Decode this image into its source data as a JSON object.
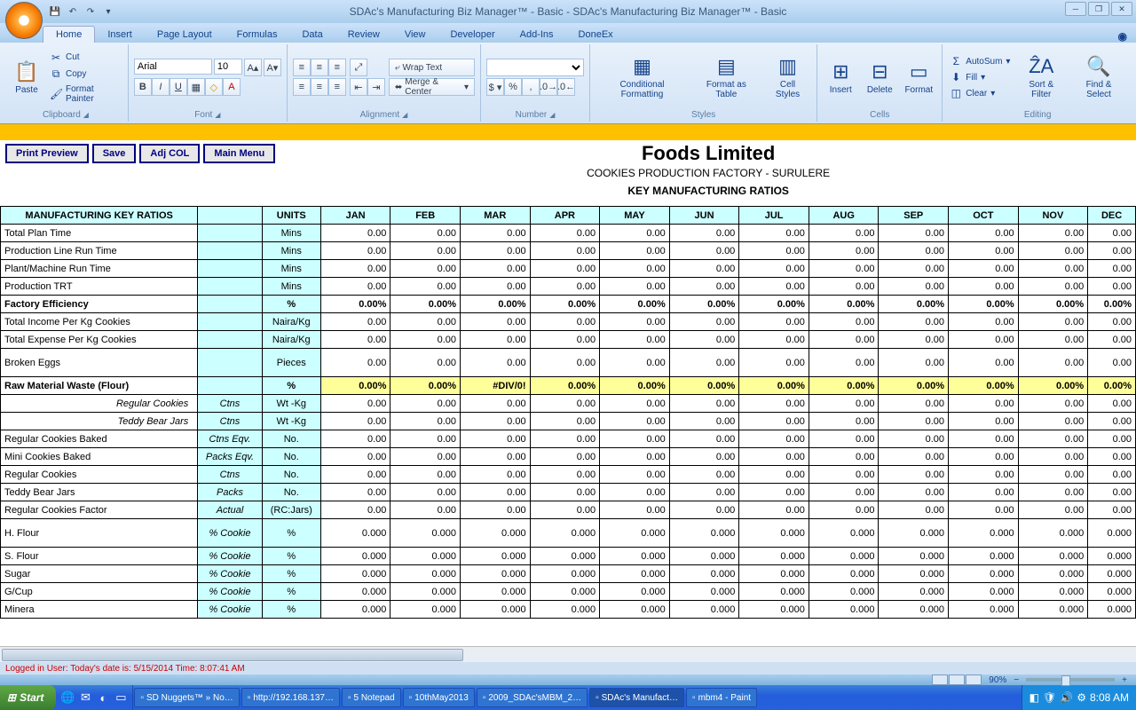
{
  "app": {
    "title": "SDAc's Manufacturing Biz Manager™ - Basic - SDAc's Manufacturing Biz Manager™ - Basic",
    "tabs": [
      "Home",
      "Insert",
      "Page Layout",
      "Formulas",
      "Data",
      "Review",
      "View",
      "Developer",
      "Add-Ins",
      "DoneEx"
    ]
  },
  "clipboard": {
    "paste": "Paste",
    "cut": "Cut",
    "copy": "Copy",
    "fp": "Format Painter",
    "label": "Clipboard"
  },
  "font": {
    "name": "Arial",
    "size": "10",
    "label": "Font"
  },
  "alignment": {
    "wrap": "Wrap Text",
    "merge": "Merge & Center",
    "label": "Alignment"
  },
  "number": {
    "label": "Number"
  },
  "styles": {
    "cond": "Conditional Formatting",
    "fas": "Format as Table",
    "cell": "Cell Styles",
    "label": "Styles"
  },
  "cells": {
    "insert": "Insert",
    "delete": "Delete",
    "format": "Format",
    "label": "Cells"
  },
  "editing": {
    "autosum": "AutoSum",
    "fill": "Fill",
    "clear": "Clear",
    "sort": "Sort & Filter",
    "find": "Find & Select",
    "label": "Editing"
  },
  "sheet": {
    "actions": {
      "preview": "Print Preview",
      "save": "Save",
      "adj": "Adj COL",
      "menu": "Main Menu"
    },
    "company": "Foods Limited",
    "subtitle": "COOKIES PRODUCTION FACTORY - SURULERE",
    "keytitle": "KEY MANUFACTURING RATIOS",
    "th_label": "MANUFACTURING KEY RATIOS",
    "th_units": "UNITS",
    "months": [
      "JAN",
      "FEB",
      "MAR",
      "APR",
      "MAY",
      "JUN",
      "JUL",
      "AUG",
      "SEP",
      "OCT",
      "NOV",
      "DEC"
    ],
    "rows": [
      {
        "label": "Total Plan Time",
        "sub": "",
        "units": "Mins",
        "vals": [
          "0.00",
          "0.00",
          "0.00",
          "0.00",
          "0.00",
          "0.00",
          "0.00",
          "0.00",
          "0.00",
          "0.00",
          "0.00",
          "0.00"
        ]
      },
      {
        "label": "Production Line Run Time",
        "sub": "",
        "units": "Mins",
        "vals": [
          "0.00",
          "0.00",
          "0.00",
          "0.00",
          "0.00",
          "0.00",
          "0.00",
          "0.00",
          "0.00",
          "0.00",
          "0.00",
          "0.00"
        ]
      },
      {
        "label": "Plant/Machine Run Time",
        "sub": "",
        "units": "Mins",
        "vals": [
          "0.00",
          "0.00",
          "0.00",
          "0.00",
          "0.00",
          "0.00",
          "0.00",
          "0.00",
          "0.00",
          "0.00",
          "0.00",
          "0.00"
        ]
      },
      {
        "label": "Production TRT",
        "sub": "",
        "units": "Mins",
        "vals": [
          "0.00",
          "0.00",
          "0.00",
          "0.00",
          "0.00",
          "0.00",
          "0.00",
          "0.00",
          "0.00",
          "0.00",
          "0.00",
          "0.00"
        ]
      },
      {
        "label": "Factory Efficiency",
        "sub": "",
        "units": "%",
        "vals": [
          "0.00%",
          "0.00%",
          "0.00%",
          "0.00%",
          "0.00%",
          "0.00%",
          "0.00%",
          "0.00%",
          "0.00%",
          "0.00%",
          "0.00%",
          "0.00%"
        ],
        "bold": true
      },
      {
        "label": "Total Income Per Kg Cookies",
        "sub": "",
        "units": "Naira/Kg",
        "vals": [
          "0.00",
          "0.00",
          "0.00",
          "0.00",
          "0.00",
          "0.00",
          "0.00",
          "0.00",
          "0.00",
          "0.00",
          "0.00",
          "0.00"
        ]
      },
      {
        "label": "Total Expense Per Kg Cookies",
        "sub": "",
        "units": "Naira/Kg",
        "vals": [
          "0.00",
          "0.00",
          "0.00",
          "0.00",
          "0.00",
          "0.00",
          "0.00",
          "0.00",
          "0.00",
          "0.00",
          "0.00",
          "0.00"
        ]
      },
      {
        "label": "Broken Eggs",
        "sub": "",
        "units": "Pieces",
        "vals": [
          "0.00",
          "0.00",
          "0.00",
          "0.00",
          "0.00",
          "0.00",
          "0.00",
          "0.00",
          "0.00",
          "0.00",
          "0.00",
          "0.00"
        ],
        "big": true
      },
      {
        "label": "Raw Material Waste (Flour)",
        "sub": "",
        "units": "%",
        "vals": [
          "0.00%",
          "0.00%",
          "#DIV/0!",
          "0.00%",
          "0.00%",
          "0.00%",
          "0.00%",
          "0.00%",
          "0.00%",
          "0.00%",
          "0.00%",
          "0.00%"
        ],
        "yellow": true,
        "bold": true
      },
      {
        "label": "Regular Cookies",
        "sub": "Ctns",
        "units": "Wt -Kg",
        "vals": [
          "0.00",
          "0.00",
          "0.00",
          "0.00",
          "0.00",
          "0.00",
          "0.00",
          "0.00",
          "0.00",
          "0.00",
          "0.00",
          "0.00"
        ],
        "indent": true
      },
      {
        "label": "Teddy Bear Jars",
        "sub": "Ctns",
        "units": "Wt -Kg",
        "vals": [
          "0.00",
          "0.00",
          "0.00",
          "0.00",
          "0.00",
          "0.00",
          "0.00",
          "0.00",
          "0.00",
          "0.00",
          "0.00",
          "0.00"
        ],
        "indent": true
      },
      {
        "label": "Regular Cookies Baked",
        "sub": "Ctns Eqv.",
        "units": "No.",
        "vals": [
          "0.00",
          "0.00",
          "0.00",
          "0.00",
          "0.00",
          "0.00",
          "0.00",
          "0.00",
          "0.00",
          "0.00",
          "0.00",
          "0.00"
        ]
      },
      {
        "label": "Mini Cookies Baked",
        "sub": "Packs Eqv.",
        "units": "No.",
        "vals": [
          "0.00",
          "0.00",
          "0.00",
          "0.00",
          "0.00",
          "0.00",
          "0.00",
          "0.00",
          "0.00",
          "0.00",
          "0.00",
          "0.00"
        ]
      },
      {
        "label": "Regular Cookies",
        "sub": "Ctns",
        "units": "No.",
        "vals": [
          "0.00",
          "0.00",
          "0.00",
          "0.00",
          "0.00",
          "0.00",
          "0.00",
          "0.00",
          "0.00",
          "0.00",
          "0.00",
          "0.00"
        ]
      },
      {
        "label": "Teddy Bear Jars",
        "sub": "Packs",
        "units": "No.",
        "vals": [
          "0.00",
          "0.00",
          "0.00",
          "0.00",
          "0.00",
          "0.00",
          "0.00",
          "0.00",
          "0.00",
          "0.00",
          "0.00",
          "0.00"
        ]
      },
      {
        "label": "Regular Cookies Factor",
        "sub": "Actual",
        "units": "(RC:Jars)",
        "vals": [
          "0.00",
          "0.00",
          "0.00",
          "0.00",
          "0.00",
          "0.00",
          "0.00",
          "0.00",
          "0.00",
          "0.00",
          "0.00",
          "0.00"
        ]
      },
      {
        "label": "H. Flour",
        "sub": "% Cookie",
        "units": "%",
        "vals": [
          "0.000",
          "0.000",
          "0.000",
          "0.000",
          "0.000",
          "0.000",
          "0.000",
          "0.000",
          "0.000",
          "0.000",
          "0.000",
          "0.000"
        ],
        "big": true
      },
      {
        "label": "S. Flour",
        "sub": "% Cookie",
        "units": "%",
        "vals": [
          "0.000",
          "0.000",
          "0.000",
          "0.000",
          "0.000",
          "0.000",
          "0.000",
          "0.000",
          "0.000",
          "0.000",
          "0.000",
          "0.000"
        ]
      },
      {
        "label": "Sugar",
        "sub": "% Cookie",
        "units": "%",
        "vals": [
          "0.000",
          "0.000",
          "0.000",
          "0.000",
          "0.000",
          "0.000",
          "0.000",
          "0.000",
          "0.000",
          "0.000",
          "0.000",
          "0.000"
        ]
      },
      {
        "label": "G/Cup",
        "sub": "% Cookie",
        "units": "%",
        "vals": [
          "0.000",
          "0.000",
          "0.000",
          "0.000",
          "0.000",
          "0.000",
          "0.000",
          "0.000",
          "0.000",
          "0.000",
          "0.000",
          "0.000"
        ]
      },
      {
        "label": "Minera",
        "sub": "% Cookie",
        "units": "%",
        "vals": [
          "0.000",
          "0.000",
          "0.000",
          "0.000",
          "0.000",
          "0.000",
          "0.000",
          "0.000",
          "0.000",
          "0.000",
          "0.000",
          "0.000"
        ]
      }
    ]
  },
  "status": {
    "user": "Logged in User:  Today's date is: 5/15/2014 Time: 8:07:41 AM",
    "zoom": "90%"
  },
  "taskbar": {
    "start": "Start",
    "tasks": [
      "SD Nuggets™ » No…",
      "http://192.168.137…",
      "5 Notepad",
      "10thMay2013",
      "2009_SDAc'sMBM_2…",
      "SDAc's Manufact…",
      "mbm4 - Paint"
    ],
    "time": "8:08 AM"
  }
}
